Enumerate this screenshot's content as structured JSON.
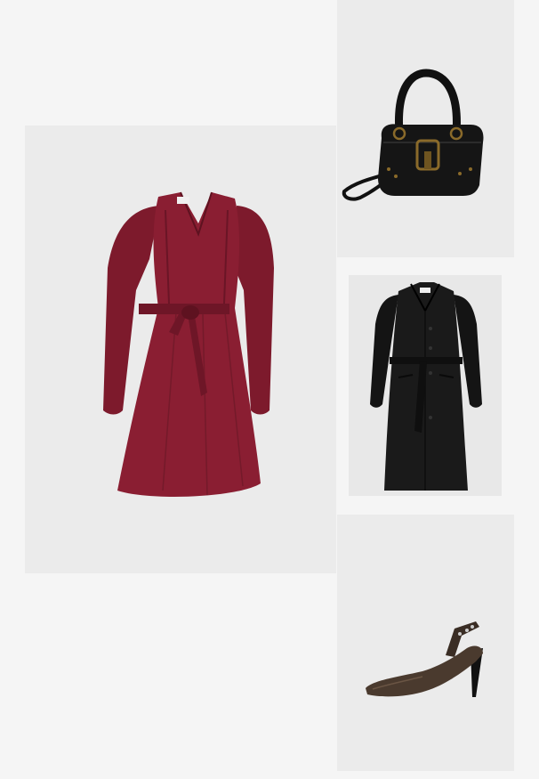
{
  "collage": {
    "items": [
      {
        "id": "dress",
        "icon": "wrap-dress-image",
        "color": "#8a1e32"
      },
      {
        "id": "bag",
        "icon": "shoulder-bag-image",
        "color": "#111111"
      },
      {
        "id": "coat",
        "icon": "long-coat-image",
        "color": "#151515"
      },
      {
        "id": "shoe",
        "icon": "slingback-pump-image",
        "color": "#4a3a2e"
      }
    ],
    "background": "#f5f5f5",
    "tile_background": "#ebebeb"
  }
}
